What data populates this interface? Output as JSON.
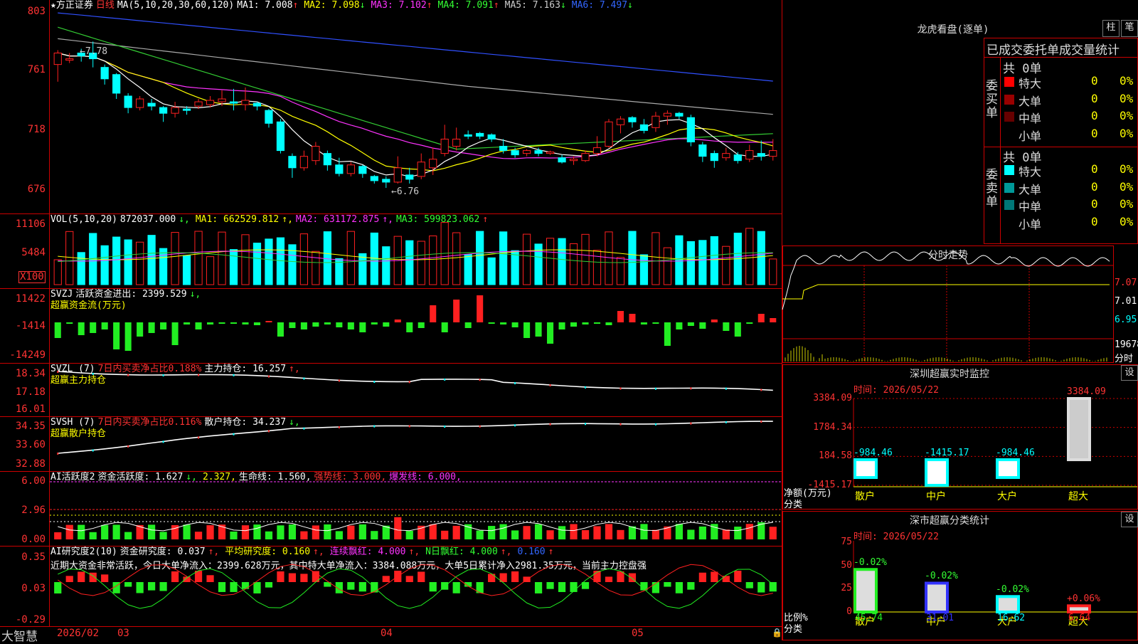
{
  "header": {
    "title": "★方正证券",
    "period": "日线",
    "ma_label": "MA(5,10,20,30,60,120)",
    "ma": [
      {
        "label": "MA1:",
        "value": "7.008",
        "arrow": "↑",
        "color": "#ffffff"
      },
      {
        "label": "MA2:",
        "value": "7.098",
        "arrow": "↓",
        "color": "#ffff00"
      },
      {
        "label": "MA3:",
        "value": "7.102",
        "arrow": "↑",
        "color": "#ff33ff"
      },
      {
        "label": "MA4:",
        "value": "7.091",
        "arrow": "↑",
        "color": "#33ff33"
      },
      {
        "label": "MA5:",
        "value": "7.163",
        "arrow": "↓",
        "color": "#cccccc"
      },
      {
        "label": "MA6:",
        "value": "7.497",
        "arrow": "↓",
        "color": "#3366ff"
      }
    ],
    "price_axis": [
      "803",
      "761",
      "718",
      "676"
    ],
    "high_mark": "7.78",
    "low_mark": "6.76"
  },
  "vol": {
    "label": "VOL(5,10,20)",
    "value": "872037.000",
    "ma1": "MA1: 662529.812",
    "ma2": "MA2: 631172.875",
    "ma3": "MA3: 599823.062",
    "axis": [
      "11106",
      "5484"
    ],
    "unit": "X100"
  },
  "svzj": {
    "label": "SVZJ",
    "line1": "活跃资金进出: 2399.529",
    "line2": "超赢资金流(万元)",
    "axis": [
      "11422",
      "-1414",
      "-14249"
    ]
  },
  "svzl": {
    "label": "SVZL (7)",
    "pct": "7日内买卖净占比0.188%",
    "hold": "主力持仓: 16.257",
    "line2": "超赢主力持仓",
    "axis": [
      "18.34",
      "17.18",
      "16.01"
    ]
  },
  "svsh": {
    "label": "SVSH (7)",
    "pct": "7日内买卖净占比0.116%",
    "hold": "散户持仓: 34.237",
    "line2": "超赢散户持仓",
    "axis": [
      "34.35",
      "33.60",
      "32.88"
    ]
  },
  "ai1": {
    "label": "AI活跃度2",
    "a": "资金活跃度: 1.627",
    "b": "2.327,",
    "c": "生命线: 1.560,",
    "d": "强势线: 3.000,",
    "e": "爆发线: 6.000,",
    "axis": [
      "6.00",
      "2.96",
      "0.00"
    ]
  },
  "ai2": {
    "label": "AI研究度2(10)",
    "a": "资金研究度: 0.037",
    "b": "平均研究度: 0.160",
    "c": "连续飘红: 4.000",
    "d": "N日飘红: 4.000",
    "e": "0.160",
    "commentary": "近期大资金非常活跃，今日大单净流入：2399.628万元，其中特大单净流入：3384.088万元，大单5日累计净入2981.35万元，当前主力控盘强",
    "axis": [
      "0.35",
      "0.03",
      "-0.29"
    ]
  },
  "footer": {
    "brand": "大智慧",
    "dates": [
      "2026/02",
      "03",
      "04",
      "05"
    ]
  },
  "right": {
    "lhb_title": "龙虎看盘(逐单)",
    "btn_col": "柱",
    "btn_pen": "笔",
    "stat_title": "已成交委托单成交量统计",
    "buy_label": "委买单",
    "sell_label": "委卖单",
    "buy_total": "共 0单",
    "sell_total": "共 0单",
    "buy_rows": [
      {
        "name": "特大",
        "n": "0",
        "p": "0%",
        "color": "#ff0000"
      },
      {
        "name": "大单",
        "n": "0",
        "p": "0%",
        "color": "#990000"
      },
      {
        "name": "中单",
        "n": "0",
        "p": "0%",
        "color": "#660000"
      },
      {
        "name": "小单",
        "n": "0",
        "p": "0%",
        "color": ""
      }
    ],
    "sell_rows": [
      {
        "name": "特大",
        "n": "0",
        "p": "0%",
        "color": "#00ffff"
      },
      {
        "name": "大单",
        "n": "0",
        "p": "0%",
        "color": "#009999"
      },
      {
        "name": "中单",
        "n": "0",
        "p": "0%",
        "color": "#007777"
      },
      {
        "name": "小单",
        "n": "0",
        "p": "0%",
        "color": ""
      }
    ],
    "fs_title": "分时走势",
    "fs_axis": [
      "7.07",
      "7.01",
      "6.95"
    ],
    "fs_vol": "19678",
    "fs_unit": "分时",
    "sz_title": "深圳超赢实时监控",
    "sz_btn": "设",
    "sz_time": "时间: 2026/05/22",
    "sz_axis": [
      "3384.09",
      "1784.34",
      "184.58",
      "-1415.17"
    ],
    "sz_bars": [
      {
        "label": "散户",
        "value": -984.46,
        "text": "-984.46"
      },
      {
        "label": "中户",
        "value": -1415.17,
        "text": "-1415.17"
      },
      {
        "label": "大户",
        "value": -984.46,
        "text": "-984.46"
      },
      {
        "label": "超大",
        "value": 3384.09,
        "text": "3384.09"
      }
    ],
    "sz_ylab1": "净额(万元)",
    "sz_ylab2": "分类",
    "fl_title": "深市超赢分类统计",
    "fl_btn": "设",
    "fl_time": "时间: 2026/05/22",
    "fl_axis": [
      "75",
      "50",
      "25",
      "0"
    ],
    "fl_bars": [
      {
        "label": "散户",
        "value": 45.74,
        "text": "45.74",
        "delta": "-0.02%"
      },
      {
        "label": "中户",
        "value": 31.01,
        "text": "31.01",
        "delta": "-0.02%"
      },
      {
        "label": "大户",
        "value": 16.62,
        "text": "16.62",
        "delta": "-0.02%"
      },
      {
        "label": "超大",
        "value": 6.64,
        "text": "6.64",
        "delta": "+0.06%"
      }
    ],
    "fl_ylab1": "比例%",
    "fl_ylab2": "分类"
  },
  "chart_data": {
    "type": "candlestick",
    "dates_axis": [
      "2026/02",
      "03",
      "04",
      "05"
    ],
    "price_range": [
      6.7,
      8.05
    ],
    "candles": [
      [
        7.62,
        7.7,
        7.5,
        7.72
      ],
      [
        7.65,
        7.66,
        7.63,
        7.7
      ],
      [
        7.7,
        7.68,
        7.64,
        7.73
      ],
      [
        7.7,
        7.66,
        7.6,
        7.78
      ],
      [
        7.6,
        7.52,
        7.48,
        7.62
      ],
      [
        7.55,
        7.42,
        7.38,
        7.56
      ],
      [
        7.4,
        7.32,
        7.28,
        7.42
      ],
      [
        7.32,
        7.38,
        7.3,
        7.4
      ],
      [
        7.35,
        7.33,
        7.3,
        7.38
      ],
      [
        7.32,
        7.28,
        7.22,
        7.33
      ],
      [
        7.28,
        7.32,
        7.25,
        7.36
      ],
      [
        7.31,
        7.3,
        7.27,
        7.33
      ],
      [
        7.33,
        7.36,
        7.31,
        7.38
      ],
      [
        7.34,
        7.37,
        7.32,
        7.4
      ],
      [
        7.36,
        7.38,
        7.33,
        7.44
      ],
      [
        7.36,
        7.35,
        7.3,
        7.45
      ],
      [
        7.34,
        7.37,
        7.3,
        7.46
      ],
      [
        7.35,
        7.33,
        7.3,
        7.36
      ],
      [
        7.3,
        7.21,
        7.18,
        7.31
      ],
      [
        7.22,
        7.02,
        7.0,
        7.24
      ],
      [
        6.98,
        6.9,
        6.83,
        7.0
      ],
      [
        6.9,
        6.98,
        6.88,
        7.02
      ],
      [
        6.95,
        7.05,
        6.92,
        7.08
      ],
      [
        7.0,
        6.92,
        6.88,
        7.02
      ],
      [
        6.92,
        6.86,
        6.84,
        6.97
      ],
      [
        6.86,
        6.92,
        6.84,
        6.94
      ],
      [
        6.91,
        6.86,
        6.83,
        6.92
      ],
      [
        6.84,
        6.81,
        6.79,
        6.85
      ],
      [
        6.82,
        6.8,
        6.76,
        6.84
      ],
      [
        6.8,
        6.9,
        6.79,
        6.98
      ],
      [
        6.85,
        6.82,
        6.79,
        6.9
      ],
      [
        6.84,
        6.94,
        6.82,
        7.0
      ],
      [
        6.9,
        6.96,
        6.85,
        7.04
      ],
      [
        7.0,
        7.1,
        6.98,
        7.2
      ],
      [
        7.05,
        7.1,
        7.02,
        7.18
      ],
      [
        7.13,
        7.12,
        7.1,
        7.16
      ],
      [
        7.14,
        7.12,
        7.1,
        7.15
      ],
      [
        7.13,
        7.1,
        7.08,
        7.14
      ],
      [
        7.05,
        7.02,
        7.0,
        7.1
      ],
      [
        7.02,
        6.99,
        6.97,
        7.04
      ],
      [
        7.0,
        7.02,
        6.98,
        7.03
      ],
      [
        7.02,
        7.0,
        6.98,
        7.04
      ],
      [
        7.0,
        7.01,
        6.99,
        7.02
      ],
      [
        6.97,
        6.94,
        6.93,
        6.99
      ],
      [
        6.95,
        6.96,
        6.92,
        6.98
      ],
      [
        6.95,
        7.0,
        6.94,
        7.02
      ],
      [
        7.0,
        7.04,
        6.98,
        7.12
      ],
      [
        7.05,
        7.22,
        7.04,
        7.24
      ],
      [
        7.2,
        7.24,
        7.14,
        7.26
      ],
      [
        7.25,
        7.22,
        7.18,
        7.26
      ],
      [
        7.2,
        7.16,
        7.14,
        7.24
      ],
      [
        7.18,
        7.26,
        7.15,
        7.29
      ],
      [
        7.26,
        7.28,
        7.2,
        7.3
      ],
      [
        7.28,
        7.26,
        7.24,
        7.29
      ],
      [
        7.25,
        7.08,
        7.05,
        7.27
      ],
      [
        7.06,
        6.98,
        6.94,
        7.08
      ],
      [
        7.0,
        6.95,
        6.9,
        7.02
      ],
      [
        6.97,
        7.0,
        6.95,
        7.04
      ],
      [
        6.99,
        6.95,
        6.93,
        7.01
      ],
      [
        6.96,
        7.02,
        6.94,
        7.06
      ],
      [
        7.0,
        6.98,
        6.95,
        7.09
      ],
      [
        6.98,
        7.02,
        6.95,
        7.1
      ]
    ]
  }
}
